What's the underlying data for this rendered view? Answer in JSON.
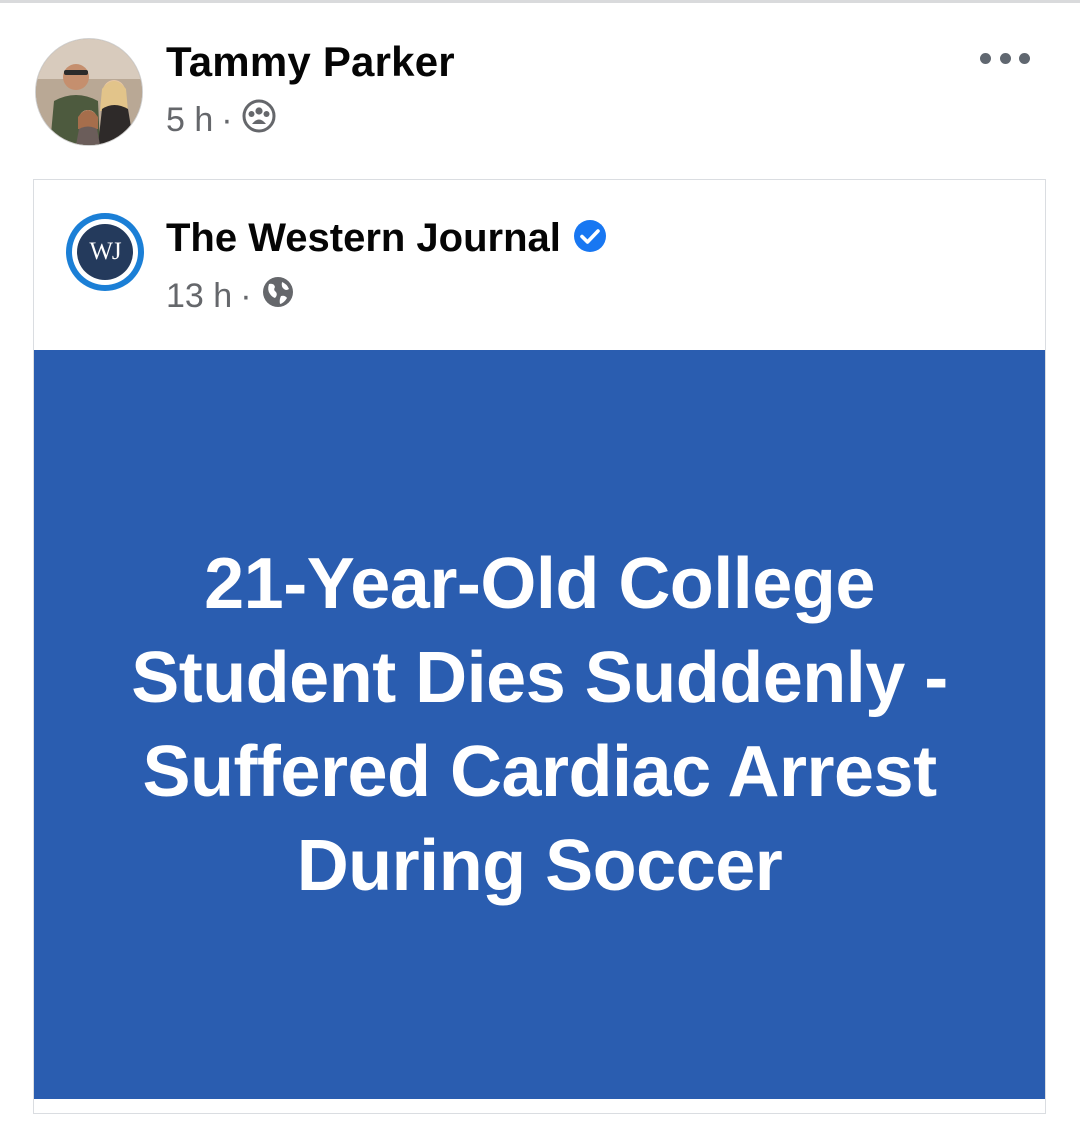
{
  "post": {
    "author_name": "Tammy Parker",
    "time": "5 h",
    "separator": "·",
    "audience_icon": "friends-icon",
    "more_icon": "more-dots-icon"
  },
  "shared": {
    "page_logo_text": "WJ",
    "page_name": "The Western Journal",
    "verified_icon": "verified-badge-icon",
    "time": "13 h",
    "separator": "·",
    "audience_icon": "globe-icon",
    "headline": "21-Year-Old College Student Dies Suddenly - Suffered Cardiac Arrest During Soccer",
    "image_bg": "#2a5db0"
  },
  "colors": {
    "verified": "#1877f2",
    "meta": "#65676b",
    "logo_ring": "#1b7fd6",
    "logo_inner": "#243a5c"
  }
}
